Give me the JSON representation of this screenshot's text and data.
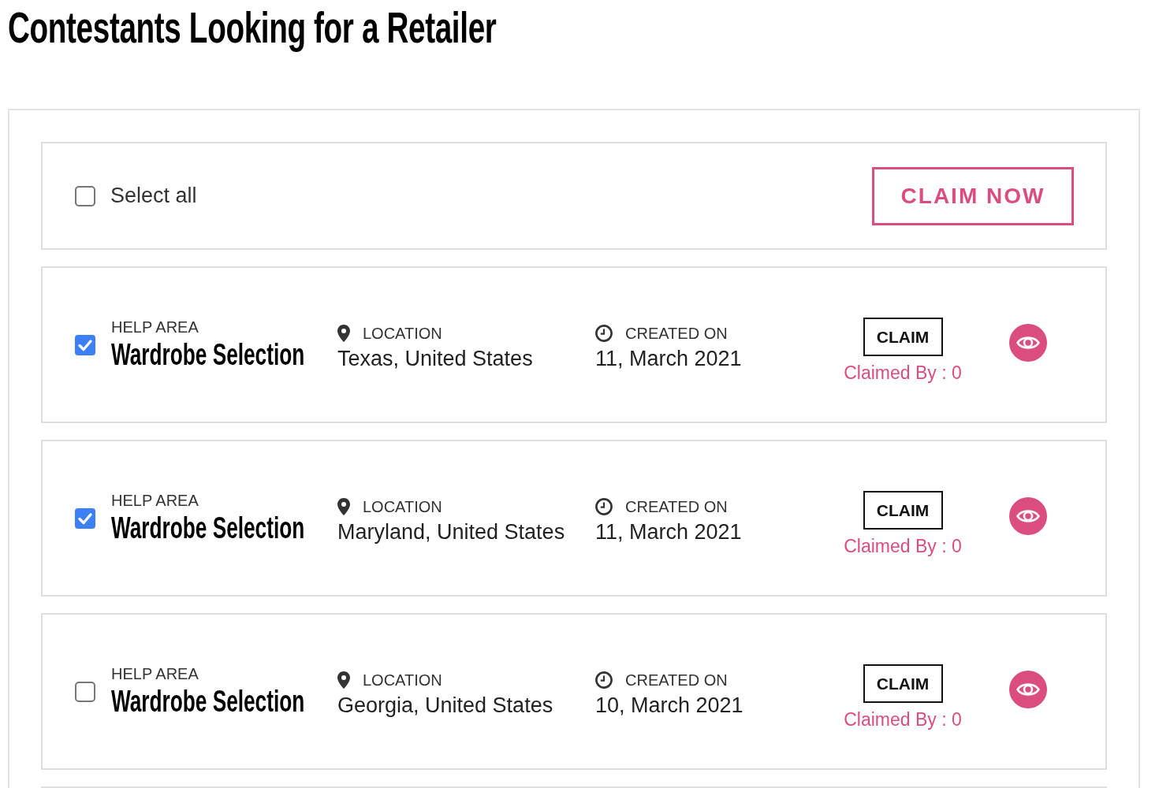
{
  "page_title": "Contestants Looking for a Retailer",
  "toolbar": {
    "select_all": {
      "label": "Select all",
      "checked": false
    },
    "claim_now_button": "CLAIM NOW"
  },
  "requests": [
    {
      "checked": true,
      "help_area_label": "HELP AREA",
      "help_area": "Wardrobe Selection",
      "location_label": "LOCATION",
      "location": "Texas, United States",
      "created_label": "CREATED ON",
      "created_on": "11, March 2021",
      "claim_button": "CLAIM",
      "claimed_by": "Claimed By : 0"
    },
    {
      "checked": true,
      "help_area_label": "HELP AREA",
      "help_area": "Wardrobe Selection",
      "location_label": "LOCATION",
      "location": "Maryland, United States",
      "created_label": "CREATED ON",
      "created_on": "11, March 2021",
      "claim_button": "CLAIM",
      "claimed_by": "Claimed By : 0"
    },
    {
      "checked": false,
      "help_area_label": "HELP AREA",
      "help_area": "Wardrobe Selection",
      "location_label": "LOCATION",
      "location": "Georgia, United States",
      "created_label": "CREATED ON",
      "created_on": "10, March 2021",
      "claim_button": "CLAIM",
      "claimed_by": "Claimed By : 0"
    }
  ]
}
